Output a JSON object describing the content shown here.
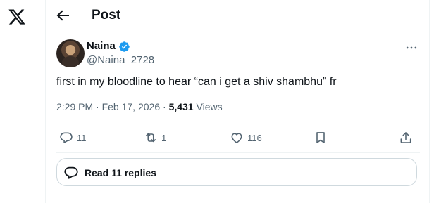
{
  "header": {
    "title": "Post"
  },
  "tweet": {
    "display_name": "Naina",
    "handle": "@Naina_2728",
    "text": "first in my bloodline to hear “can i get a shiv shambhu” fr",
    "time": "2:29 PM",
    "date": "Feb 17, 2026",
    "views_count": "5,431",
    "views_label": "Views",
    "verified_color": "#1d9bf0"
  },
  "actions": {
    "reply_count": "11",
    "retweet_count": "1",
    "like_count": "116"
  },
  "replies": {
    "label": "Read 11 replies"
  }
}
